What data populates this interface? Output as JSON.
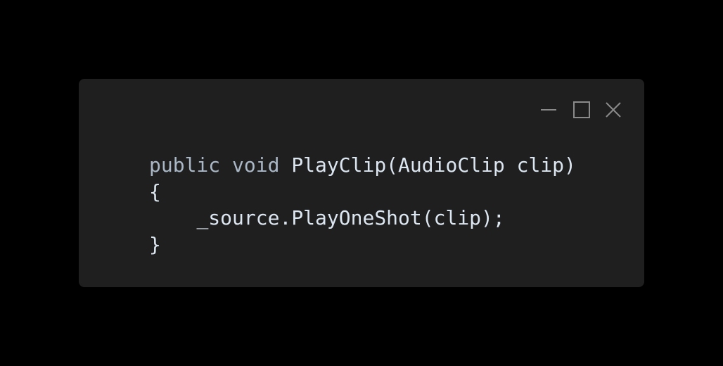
{
  "window": {
    "controls": {
      "minimize": "minimize-icon",
      "maximize": "maximize-icon",
      "close": "close-icon"
    }
  },
  "code": {
    "lines": [
      "public void PlayClip(AudioClip clip)",
      "{",
      "    _source.PlayOneShot(clip);",
      "}"
    ]
  },
  "colors": {
    "background": "#000000",
    "window": "#1f1f1f",
    "keyword": "#a9b7c6",
    "text": "#dce6f0",
    "control": "#8a8a8a"
  }
}
